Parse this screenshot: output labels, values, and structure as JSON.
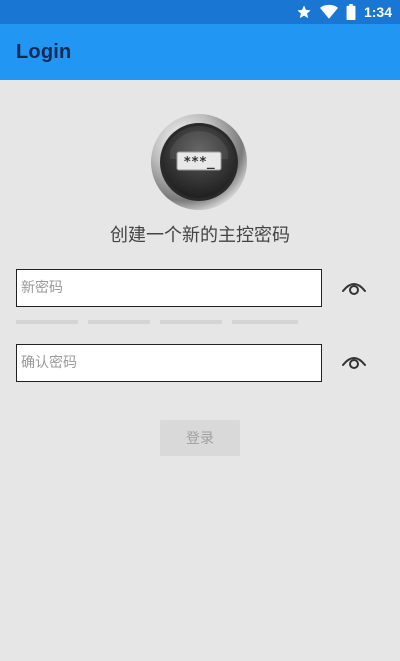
{
  "status_bar": {
    "time": "1:34",
    "icons": [
      "star-icon",
      "wifi-icon",
      "battery-icon"
    ],
    "color": "#1976d2"
  },
  "app_bar": {
    "title": "Login",
    "color": "#2196f3"
  },
  "logo": {
    "icon": "password-lock-icon",
    "text": "***_"
  },
  "form": {
    "heading": "创建一个新的主控密码",
    "new_password": {
      "placeholder": "新密码",
      "value": ""
    },
    "strength_meter": {
      "segments": 4,
      "filled": 0
    },
    "confirm_password": {
      "placeholder": "确认密码",
      "value": ""
    },
    "login_label": "登录",
    "login_enabled": false
  }
}
